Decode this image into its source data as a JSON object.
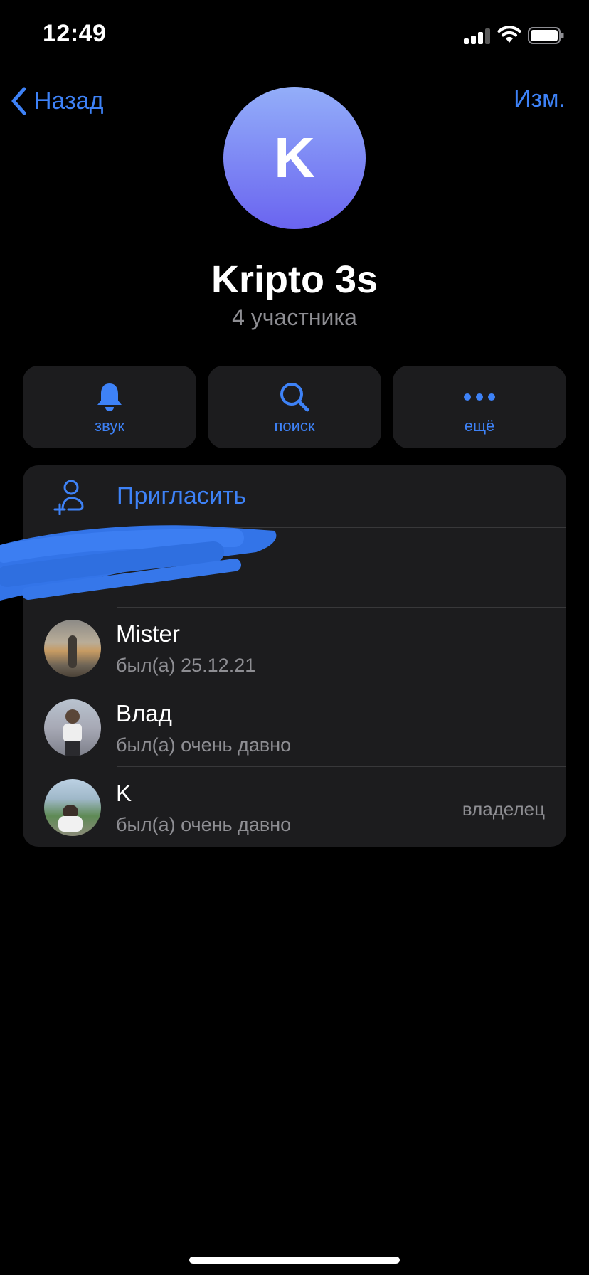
{
  "status_bar": {
    "time": "12:49"
  },
  "nav": {
    "back_label": "Назад",
    "edit_label": "Изм."
  },
  "group": {
    "avatar_letter": "K",
    "title": "Kripto 3s",
    "subtitle": "4 участника"
  },
  "actions": [
    {
      "label": "звук",
      "icon": "bell-icon"
    },
    {
      "label": "поиск",
      "icon": "search-icon"
    },
    {
      "label": "ещё",
      "icon": "more-icon"
    }
  ],
  "invite": {
    "label": "Пригласить",
    "icon": "add-user-icon"
  },
  "members": [
    {
      "name": "Mister",
      "status": "был(а) 25.12.21",
      "role": ""
    },
    {
      "name": "Влад",
      "status": "был(а) очень давно",
      "role": ""
    },
    {
      "name": "K",
      "status": "был(а) очень давно",
      "role": "владелец"
    }
  ],
  "colors": {
    "accent": "#3e82f7",
    "card": "#1c1c1e",
    "background": "#000000",
    "secondary_text": "#8e8e93"
  }
}
